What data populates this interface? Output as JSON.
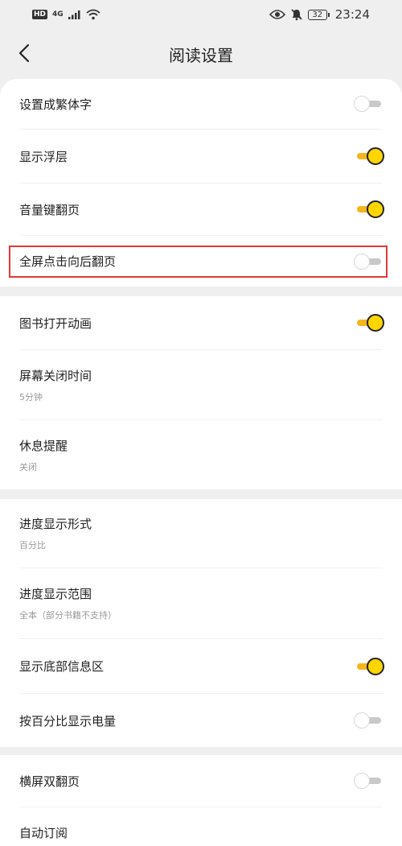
{
  "status_bar": {
    "hd": "HD",
    "network": "4G",
    "time": "23:24",
    "battery": "32"
  },
  "header": {
    "title": "阅读设置"
  },
  "sections": [
    [
      {
        "label": "设置成繁体字",
        "toggle": "off"
      },
      {
        "label": "显示浮层",
        "toggle": "on"
      },
      {
        "label": "音量键翻页",
        "toggle": "on"
      },
      {
        "label": "全屏点击向后翻页",
        "toggle": "off",
        "highlighted": true
      }
    ],
    [
      {
        "label": "图书打开动画",
        "toggle": "on"
      },
      {
        "label": "屏幕关闭时间",
        "sub": "5分钟"
      },
      {
        "label": "休息提醒",
        "sub": "关闭"
      }
    ],
    [
      {
        "label": "进度显示形式",
        "sub": "百分比"
      },
      {
        "label": "进度显示范围",
        "sub": "全本（部分书籍不支持）"
      },
      {
        "label": "显示底部信息区",
        "toggle": "on"
      },
      {
        "label": "按百分比显示电量",
        "toggle": "off"
      }
    ],
    [
      {
        "label": "横屏双翻页",
        "toggle": "off"
      },
      {
        "label": "自动订阅"
      }
    ]
  ],
  "colors": {
    "accent": "#ffd600",
    "highlight_border": "#e53935"
  }
}
